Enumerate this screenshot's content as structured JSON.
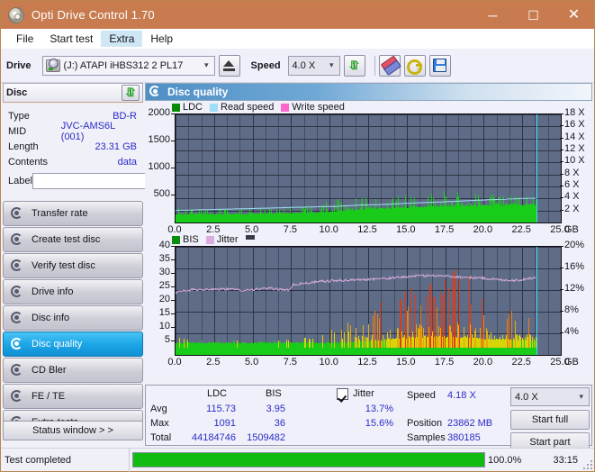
{
  "window": {
    "title": "Opti Drive Control 1.70",
    "icon": "disc-icon",
    "minimize": "─",
    "maximize": "☐",
    "close": "✕"
  },
  "menu": {
    "items": [
      "File",
      "Start test",
      "Extra",
      "Help"
    ],
    "highlighted": "Extra"
  },
  "toolbar": {
    "drive_label": "Drive",
    "drive_value": "(J:)   ATAPI iHBS312   2 PL17",
    "drive_icon": "drive-icon",
    "eject_icon": "eject-icon",
    "speed_label": "Speed",
    "speed_value": "4.0 X",
    "refresh_icon": "refresh-icon",
    "eraser_icon": "eraser-icon",
    "key_icon": "key-icon",
    "save_icon": "save-icon"
  },
  "disc_panel": {
    "header": "Disc",
    "header_icon": "refresh-icon",
    "rows": [
      {
        "key": "Type",
        "value": "BD-R"
      },
      {
        "key": "MID",
        "value": "JVC-AMS6L (001)"
      },
      {
        "key": "Length",
        "value": "23.31 GB"
      },
      {
        "key": "Contents",
        "value": "data"
      }
    ],
    "label_key": "Label",
    "label_value": "",
    "label_placeholder": "",
    "cd_icon": "cd-icon"
  },
  "nav": {
    "items": [
      {
        "label": "Transfer rate",
        "icon": "disc-test-icon",
        "active": false
      },
      {
        "label": "Create test disc",
        "icon": "disc-test-icon",
        "active": false
      },
      {
        "label": "Verify test disc",
        "icon": "disc-test-icon",
        "active": false
      },
      {
        "label": "Drive info",
        "icon": "disc-test-icon",
        "active": false
      },
      {
        "label": "Disc info",
        "icon": "disc-test-icon",
        "active": false
      },
      {
        "label": "Disc quality",
        "icon": "disc-test-icon",
        "active": true
      },
      {
        "label": "CD Bler",
        "icon": "disc-test-icon",
        "active": false
      },
      {
        "label": "FE / TE",
        "icon": "disc-test-icon",
        "active": false
      },
      {
        "label": "Extra tests",
        "icon": "disc-test-icon",
        "active": false
      }
    ],
    "status_window_button": "Status window > >"
  },
  "content": {
    "header": "Disc quality",
    "header_icon": "disc-quality-icon"
  },
  "stats": {
    "col_headers": [
      "LDC",
      "BIS"
    ],
    "row_labels": [
      "Avg",
      "Max",
      "Total"
    ],
    "ldc": {
      "avg": "115.73",
      "max": "1091",
      "total": "44184746"
    },
    "bis": {
      "avg": "3.95",
      "max": "36",
      "total": "1509482"
    },
    "jitter": {
      "label": "Jitter",
      "checked": true,
      "avg": "13.7%",
      "max": "15.6%"
    },
    "speed_label": "Speed",
    "speed_value": "4.18 X",
    "position_label": "Position",
    "position_value": "23862 MB",
    "samples_label": "Samples",
    "samples_value": "380185",
    "speed_select": "4.0 X",
    "start_full_button": "Start full",
    "start_part_button": "Start part"
  },
  "statusbar": {
    "text": "Test completed",
    "percent_label": "100.0%",
    "percent_value": 100,
    "elapsed": "33:15"
  },
  "colors": {
    "titlebar": "#c87b4f",
    "accent_blue": "#1fa8e8",
    "value_text": "#2b2bc8",
    "plot_bg": "#5f6c87",
    "ldc_green": "#19cc19",
    "read_speed": "#9fdcf5",
    "write_speed": "#ff66cc",
    "bis_green": "#19cc19",
    "jitter_pink": "#d9aede",
    "progress_green": "#11bb11",
    "cursor": "#3dd8f2"
  },
  "chart_data": [
    {
      "id": "top-chart",
      "type": "area",
      "title": "Disc quality",
      "legend": [
        {
          "label": "LDC",
          "color": "#0a8a0a"
        },
        {
          "label": "Read speed",
          "color": "#9fdcf5"
        },
        {
          "label": "Write speed",
          "color": "#ff66cc"
        }
      ],
      "legend_position": "top-left",
      "grid": true,
      "xlabel": "GB",
      "xlim": [
        0,
        25
      ],
      "xticks": [
        "0.0",
        "2.5",
        "5.0",
        "7.5",
        "10.0",
        "12.5",
        "15.0",
        "17.5",
        "20.0",
        "22.5",
        "25.0"
      ],
      "ylabel_left": "",
      "ylim_left": [
        0,
        2000
      ],
      "yticks_left": [
        "500",
        "1000",
        "1500",
        "2000"
      ],
      "ylabel_right": "X",
      "ylim_right": [
        0,
        18
      ],
      "yticks_right": [
        "2 X",
        "4 X",
        "6 X",
        "8 X",
        "10 X",
        "12 X",
        "14 X",
        "16 X",
        "18 X"
      ],
      "data_end_x": 23.4,
      "cursor_x": 23.4,
      "series": [
        {
          "name": "LDC",
          "color": "#19cc19",
          "axis": "left",
          "note": "dense error-count bars; baseline band ~150-220 rising gradually, spike envelope grows from ~250 at 0GB to ~550 peak near 18GB",
          "x": [
            0.2,
            1.0,
            2.0,
            3.0,
            4.0,
            5.0,
            6.0,
            7.0,
            8.0,
            9.0,
            10.0,
            11.0,
            12.0,
            13.0,
            14.0,
            15.0,
            16.0,
            17.0,
            18.0,
            19.0,
            20.0,
            21.0,
            22.0,
            23.0,
            23.4
          ],
          "baseline": [
            150,
            155,
            158,
            160,
            163,
            168,
            172,
            176,
            180,
            190,
            205,
            230,
            250,
            265,
            278,
            290,
            300,
            310,
            318,
            322,
            325,
            330,
            335,
            340,
            340
          ],
          "envelope": [
            260,
            250,
            255,
            260,
            270,
            270,
            275,
            280,
            300,
            330,
            420,
            450,
            470,
            480,
            500,
            520,
            510,
            560,
            640,
            540,
            530,
            520,
            520,
            500,
            480
          ]
        },
        {
          "name": "Read speed",
          "color": "#9fdcf5",
          "axis": "right",
          "note": "stepped CAV-like read speed ramp",
          "x": [
            0.0,
            1.5,
            3.0,
            4.5,
            6.0,
            7.5,
            9.0,
            10.5,
            12.0,
            13.5,
            15.0,
            16.5,
            18.0,
            19.5,
            21.0,
            22.5,
            23.4
          ],
          "y": [
            2.0,
            2.1,
            2.2,
            2.3,
            2.4,
            2.5,
            2.6,
            2.7,
            2.9,
            3.0,
            3.2,
            3.35,
            3.5,
            3.7,
            3.85,
            4.0,
            4.05
          ]
        },
        {
          "name": "Write speed",
          "color": "#ff66cc",
          "axis": "right",
          "x": [],
          "y": []
        }
      ]
    },
    {
      "id": "bottom-chart",
      "type": "area",
      "legend": [
        {
          "label": "BIS",
          "color": "#0a8a0a"
        },
        {
          "label": "Jitter",
          "color": "#d9aede"
        },
        {
          "label": "",
          "color": "#3a3a46"
        }
      ],
      "legend_position": "top-left",
      "grid": true,
      "xlabel": "GB",
      "xlim": [
        0,
        25
      ],
      "xticks": [
        "0.0",
        "2.5",
        "5.0",
        "7.5",
        "10.0",
        "12.5",
        "15.0",
        "17.5",
        "20.0",
        "22.5",
        "25.0"
      ],
      "ylim_left": [
        0,
        40
      ],
      "yticks_left": [
        "5",
        "10",
        "15",
        "20",
        "25",
        "30",
        "35",
        "40"
      ],
      "ylim_right": [
        0,
        20
      ],
      "yticks_right": [
        "4%",
        "8%",
        "12%",
        "16%",
        "20%"
      ],
      "data_end_x": 23.4,
      "cursor_x": 23.4,
      "series": [
        {
          "name": "BIS",
          "color": "#19cc19",
          "axis": "left",
          "note": "error bars, baseline ~4-5 to 12.5GB then rising envelope peaking ~22-26 around 16-19GB with orange/red high spikes",
          "x": [
            0.2,
            1.0,
            2.0,
            3.0,
            4.0,
            5.0,
            6.0,
            7.0,
            8.0,
            9.0,
            10.0,
            11.0,
            12.0,
            13.0,
            14.0,
            15.0,
            16.0,
            17.0,
            18.0,
            19.0,
            20.0,
            21.0,
            22.0,
            23.0,
            23.4
          ],
          "baseline": [
            4.5,
            4.5,
            4.5,
            4.5,
            4.5,
            4.5,
            4.5,
            4.5,
            4.5,
            4.5,
            4.6,
            4.8,
            5.0,
            5.5,
            6.0,
            6.5,
            7.0,
            7.0,
            6.8,
            6.5,
            6.2,
            6.0,
            5.8,
            5.5,
            5.0
          ],
          "envelope": [
            6.5,
            5.5,
            5.5,
            5.5,
            5.5,
            5.5,
            5.5,
            5.5,
            6.0,
            7.0,
            9.0,
            12.0,
            16.0,
            19.0,
            22.0,
            26.0,
            31.0,
            29.0,
            33.0,
            30.0,
            24.0,
            22.0,
            20.0,
            17.0,
            13.0
          ]
        },
        {
          "name": "Jitter",
          "color": "#d9aede",
          "axis": "right",
          "note": "percent jitter trace",
          "x": [
            0.0,
            0.5,
            1.5,
            3.0,
            4.5,
            6.0,
            7.0,
            7.4,
            7.6,
            8.5,
            9.5,
            11.0,
            12.5,
            14.0,
            15.5,
            17.0,
            18.5,
            20.0,
            21.0,
            22.0,
            22.8,
            23.4
          ],
          "y": [
            11.5,
            12.0,
            12.1,
            12.2,
            12.0,
            12.3,
            12.1,
            11.9,
            13.0,
            13.3,
            13.6,
            13.8,
            14.0,
            14.2,
            14.6,
            14.7,
            14.4,
            14.2,
            13.9,
            13.8,
            14.0,
            14.5
          ]
        }
      ]
    }
  ]
}
